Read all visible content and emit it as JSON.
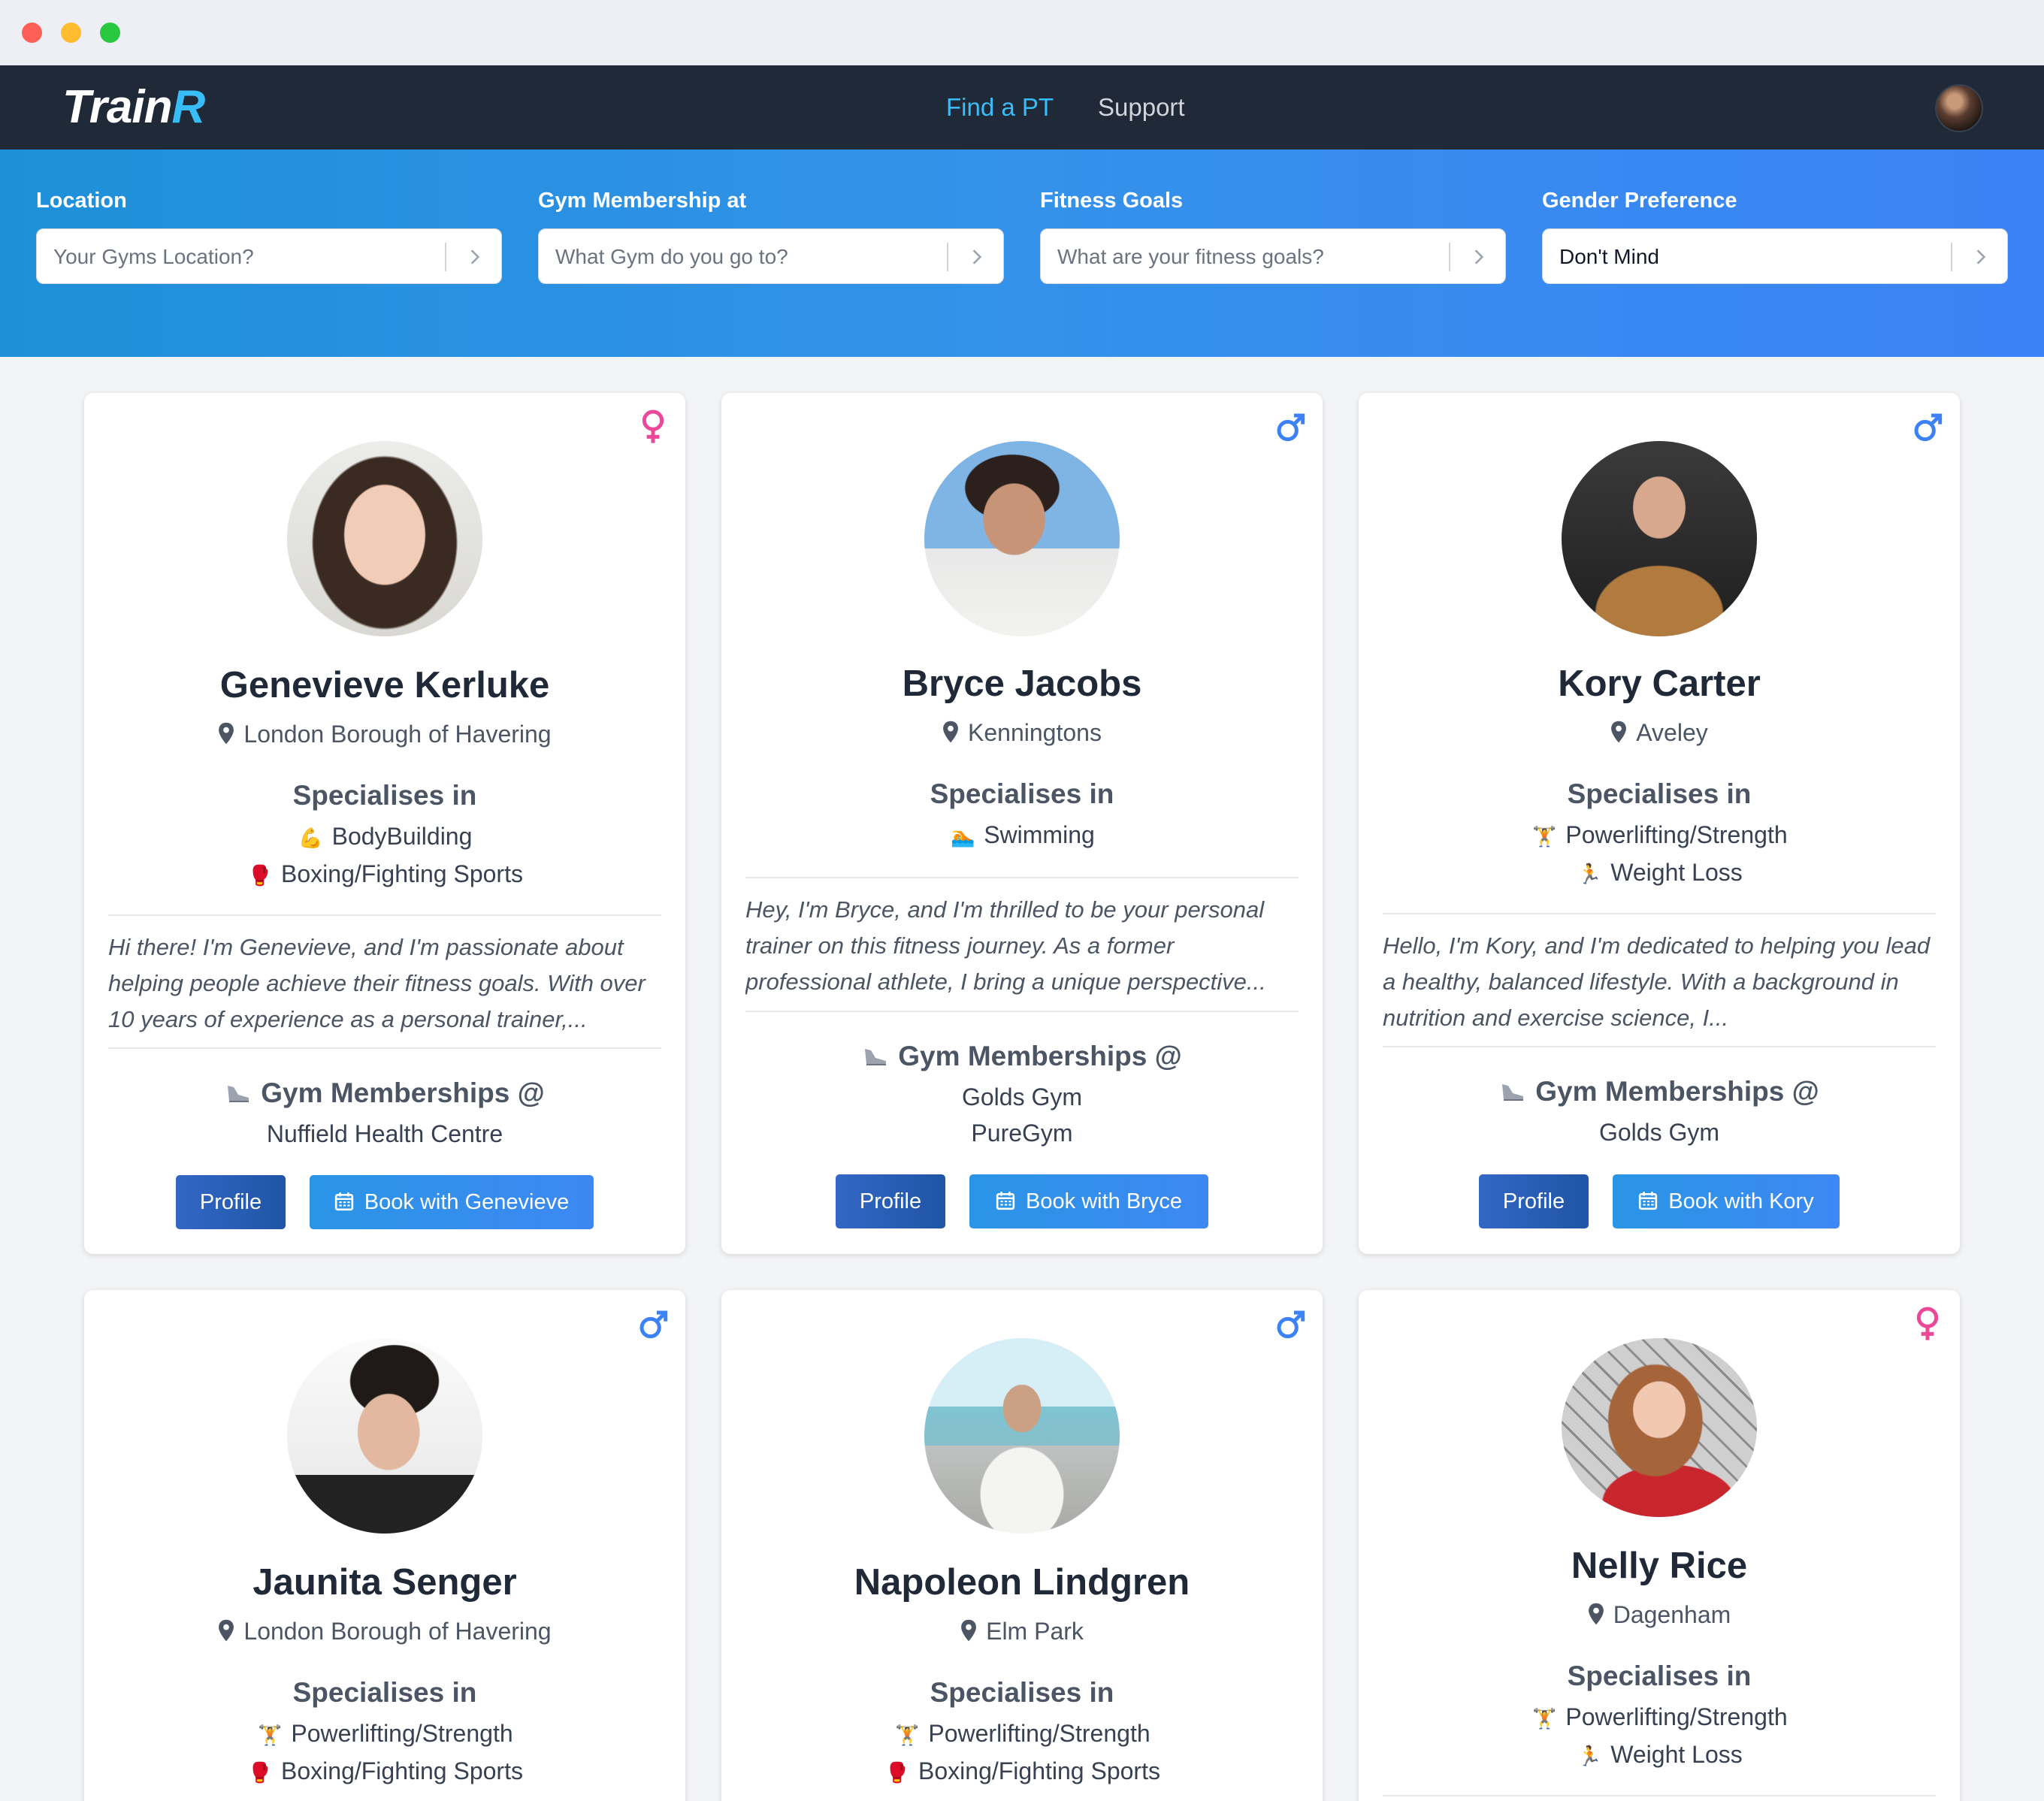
{
  "app": {
    "logo_main": "Train",
    "logo_accent": "R"
  },
  "nav": {
    "links": [
      "Find a PT",
      "Support"
    ]
  },
  "filters": [
    {
      "label": "Location",
      "placeholder": "Your Gyms Location?",
      "value": ""
    },
    {
      "label": "Gym Membership at",
      "placeholder": "What Gym do you go to?",
      "value": ""
    },
    {
      "label": "Fitness Goals",
      "placeholder": "What are your fitness goals?",
      "value": ""
    },
    {
      "label": "Gender Preference",
      "placeholder": "",
      "value": "Don't Mind"
    }
  ],
  "labels": {
    "specialises": "Specialises in",
    "gym_memberships": "Gym Memberships @",
    "profile_button": "Profile"
  },
  "colors": {
    "female": "#ec4899",
    "male": "#3b82f6"
  },
  "trainers": [
    {
      "name": "Genevieve Kerluke",
      "gender": "female",
      "location": "London Borough of Havering",
      "specialities": [
        {
          "emoji": "💪",
          "label": "BodyBuilding"
        },
        {
          "emoji": "🥊",
          "label": "Boxing/Fighting Sports"
        }
      ],
      "bio": "Hi there! I'm Genevieve, and I'm passionate about helping people achieve their fitness goals. With over 10 years of experience as a personal trainer,...",
      "gyms": [
        "Nuffield Health Centre"
      ],
      "book_label": "Book with Genevieve"
    },
    {
      "name": "Bryce Jacobs",
      "gender": "male",
      "location": "Kenningtons",
      "specialities": [
        {
          "emoji": "🏊",
          "label": "Swimming"
        }
      ],
      "bio": "Hey, I'm Bryce, and I'm thrilled to be your personal trainer on this fitness journey. As a former professional athlete, I bring a unique perspective...",
      "gyms": [
        "Golds Gym",
        "PureGym"
      ],
      "book_label": "Book with Bryce"
    },
    {
      "name": "Kory Carter",
      "gender": "male",
      "location": "Aveley",
      "specialities": [
        {
          "emoji": "🏋",
          "label": "Powerlifting/Strength"
        },
        {
          "emoji": "🏃",
          "label": "Weight Loss"
        }
      ],
      "bio": "Hello, I'm Kory, and I'm dedicated to helping you lead a healthy, balanced lifestyle. With a background in nutrition and exercise science, I...",
      "gyms": [
        "Golds Gym"
      ],
      "book_label": "Book with Kory"
    },
    {
      "name": "Jaunita Senger",
      "gender": "male",
      "location": "London Borough of Havering",
      "specialities": [
        {
          "emoji": "🏋",
          "label": "Powerlifting/Strength"
        },
        {
          "emoji": "🥊",
          "label": "Boxing/Fighting Sports"
        }
      ]
    },
    {
      "name": "Napoleon Lindgren",
      "gender": "male",
      "location": "Elm Park",
      "specialities": [
        {
          "emoji": "🏋",
          "label": "Powerlifting/Strength"
        },
        {
          "emoji": "🥊",
          "label": "Boxing/Fighting Sports"
        }
      ]
    },
    {
      "name": "Nelly Rice",
      "gender": "female",
      "location": "Dagenham",
      "specialities": [
        {
          "emoji": "🏋",
          "label": "Powerlifting/Strength"
        },
        {
          "emoji": "🏃",
          "label": "Weight Loss"
        }
      ]
    }
  ]
}
